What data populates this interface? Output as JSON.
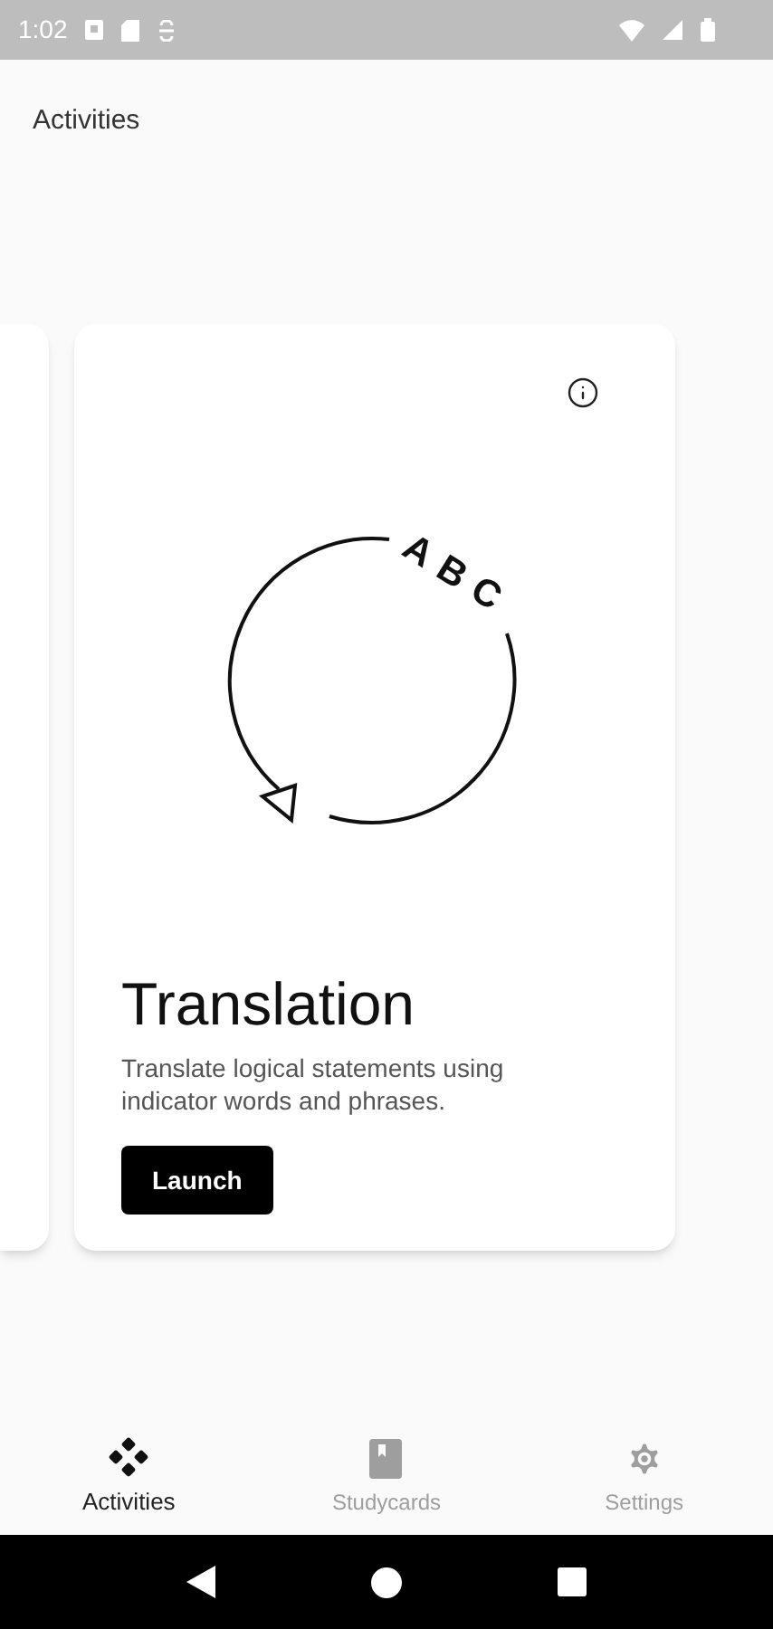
{
  "status_bar": {
    "time": "1:02"
  },
  "header": {
    "title": "Activities"
  },
  "card": {
    "illustration_text": "ABC",
    "title": "Translation",
    "description": "Translate logical statements using indicator words and phrases.",
    "button": "Launch"
  },
  "bottom_nav": [
    {
      "kind": "activities",
      "label": "Activities",
      "selected": true
    },
    {
      "kind": "studycards",
      "label": "Studycards",
      "selected": false
    },
    {
      "kind": "settings",
      "label": "Settings",
      "selected": false
    }
  ]
}
